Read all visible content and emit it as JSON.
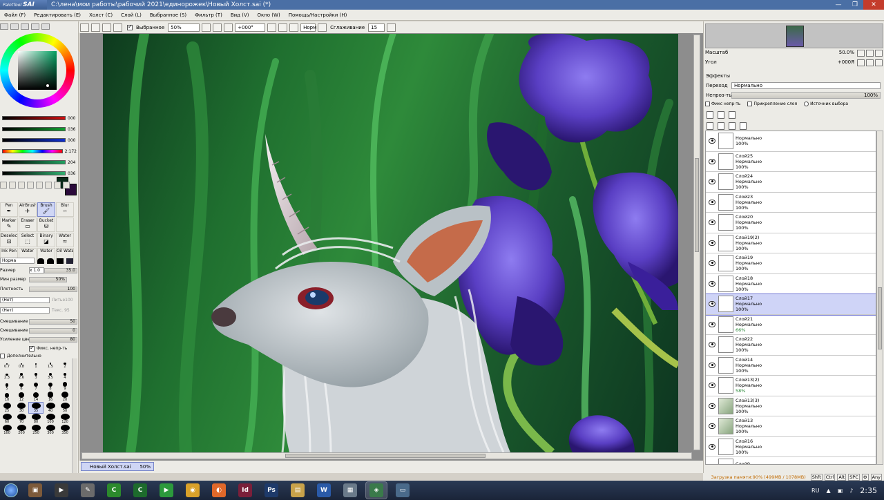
{
  "window": {
    "logo_top": "PaintTool",
    "logo_main": "SAI",
    "title": "C:\\лена\\мои работы\\рабочий 2021\\единорожек\\Новый Холст.sai (*)"
  },
  "menu": [
    "Файл (F)",
    "Редактировать (E)",
    "Холст (C)",
    "Слой (L)",
    "Выбранное (S)",
    "Фильтр (T)",
    "Вид (V)",
    "Окно (W)",
    "Помощь/Настройки (H)"
  ],
  "toolbar": {
    "selected_label": "Выбранное",
    "zoom": "50%",
    "angle": "+000°",
    "mode": "Норм",
    "smoothing_label": "Сглаживание",
    "smoothing_value": "15"
  },
  "color": {
    "sliders": [
      {
        "value": "000",
        "color": "#d01010"
      },
      {
        "value": "036",
        "color": "#10a030"
      },
      {
        "value": "000",
        "color": "#1030d0"
      },
      {
        "value": "2:172",
        "color": "#e050e0"
      },
      {
        "value": "204",
        "color": "#20a060"
      },
      {
        "value": "036",
        "color": "#30b070"
      }
    ],
    "foreground": "#0a2a1a",
    "background": "#2a0a3a"
  },
  "brushes": [
    {
      "label": "Pen",
      "glyph": "✒",
      "active": false
    },
    {
      "label": "AirBrush",
      "glyph": "✈",
      "active": false
    },
    {
      "label": "Brush",
      "glyph": "🖌",
      "active": true
    },
    {
      "label": "Blur",
      "glyph": "∽",
      "active": false
    },
    {
      "label": "Marker",
      "glyph": "✎",
      "active": false
    },
    {
      "label": "Eraser",
      "glyph": "▭",
      "active": false
    },
    {
      "label": "Bucket",
      "glyph": "⛁",
      "active": false
    },
    {
      "label": "",
      "glyph": "",
      "active": false
    },
    {
      "label": "Deselect",
      "glyph": "⊡",
      "active": false
    },
    {
      "label": "Select",
      "glyph": "⬚",
      "active": false
    },
    {
      "label": "Binary",
      "glyph": "◪",
      "active": false
    },
    {
      "label": "Water",
      "glyph": "≈",
      "active": false
    },
    {
      "label": "Ink Pen",
      "glyph": "",
      "active": false
    },
    {
      "label": "Water",
      "glyph": "",
      "active": false
    },
    {
      "label": "Water",
      "glyph": "",
      "active": false
    },
    {
      "label": "Oil Water",
      "glyph": "",
      "active": false
    }
  ],
  "brush_props": {
    "mode": "Норма",
    "size_label": "Размер",
    "size_mult": "x 1.0",
    "size_value": "35.0",
    "min_size_label": "Мин размер",
    "min_size_value": "50%",
    "density_label": "Плотность",
    "density_value": "100",
    "paper_1": "(Нет)",
    "paper_1_value": "Литье100",
    "paper_2": "(Нет)",
    "paper_2_value": "Текс. 95",
    "blend_label": "Смешивание цвет",
    "blend_value": "50",
    "dilution_label": "Смешивание непр",
    "dilution_value": "0",
    "persist_label": "Усиление цвета",
    "persist_value": "80",
    "keep_opacity": "Фикс. непр-ть",
    "advanced": "Дополнительно"
  },
  "brush_sizes": [
    "0.7",
    "0.8",
    "1",
    "1.5",
    "2",
    "2.3",
    "2.6",
    "3",
    "3.5",
    "4",
    "5",
    "6",
    "7",
    "8",
    "9",
    "10",
    "12",
    "14",
    "16",
    "20",
    "25",
    "30",
    "35",
    "40",
    "50",
    "60",
    "70",
    "80",
    "100",
    "120",
    "160",
    "200",
    "250",
    "300",
    "350"
  ],
  "selected_brush_size": "35",
  "doc_tab": {
    "name": "Новый Холст.sai",
    "zoom": "50%"
  },
  "navigator": {
    "zoom_label": "Масштаб",
    "zoom_value": "50.0%",
    "angle_label": "Угол",
    "angle_value": "+000Я"
  },
  "layer_panel": {
    "effects": "Эффекты",
    "blend_label": "Переход",
    "blend_value": "Нормально",
    "opacity_label": "Непроз-ть",
    "opacity_value": "100%",
    "preserve": "Фикс непр-ть",
    "clip": "Прикрепление слоя",
    "source": "Источник выбора"
  },
  "layers": [
    {
      "name": "",
      "mode": "Нормально",
      "opacity": "100%",
      "img": false,
      "active": false
    },
    {
      "name": "Слой25",
      "mode": "Нормально",
      "opacity": "100%",
      "img": false,
      "active": false
    },
    {
      "name": "Слой24",
      "mode": "Нормально",
      "opacity": "100%",
      "img": false,
      "active": false
    },
    {
      "name": "Слой23",
      "mode": "Нормально",
      "opacity": "100%",
      "img": false,
      "active": false
    },
    {
      "name": "Слой20",
      "mode": "Нормально",
      "opacity": "100%",
      "img": false,
      "active": false
    },
    {
      "name": "Слой19(2)",
      "mode": "Нормально",
      "opacity": "100%",
      "img": false,
      "active": false
    },
    {
      "name": "Слой19",
      "mode": "Нормально",
      "opacity": "100%",
      "img": false,
      "active": false
    },
    {
      "name": "Слой18",
      "mode": "Нормально",
      "opacity": "100%",
      "img": false,
      "active": false
    },
    {
      "name": "Слой17",
      "mode": "Нормально",
      "opacity": "100%",
      "img": false,
      "active": true
    },
    {
      "name": "Слой21",
      "mode": "Нормально",
      "opacity": "66%",
      "img": false,
      "active": false
    },
    {
      "name": "Слой22",
      "mode": "Нормально",
      "opacity": "100%",
      "img": false,
      "active": false
    },
    {
      "name": "Слой14",
      "mode": "Нормально",
      "opacity": "100%",
      "img": false,
      "active": false
    },
    {
      "name": "Слой13(2)",
      "mode": "Нормально",
      "opacity": "58%",
      "img": false,
      "active": false
    },
    {
      "name": "Слой13(3)",
      "mode": "Нормально",
      "opacity": "100%",
      "img": true,
      "active": false
    },
    {
      "name": "Слой13",
      "mode": "Нормально",
      "opacity": "100%",
      "img": true,
      "active": false
    },
    {
      "name": "Слой16",
      "mode": "Нормально",
      "opacity": "100%",
      "img": false,
      "active": false
    },
    {
      "name": "Слой9",
      "mode": "Нормально",
      "opacity": "",
      "img": false,
      "active": false
    }
  ],
  "status": {
    "memory": "Загрузка памяти:90% (499MB / 1078MB)",
    "keys": [
      "Shft",
      "Ctrl",
      "Alt",
      "SPC",
      "⚙",
      "Any"
    ]
  },
  "taskbar": {
    "apps": [
      {
        "name": "photo-viewer",
        "label": "▣",
        "color": "#7d5a3a"
      },
      {
        "name": "media",
        "label": "▶",
        "color": "#3a3a3a"
      },
      {
        "name": "paint",
        "label": "✎",
        "color": "#6b6b6b"
      },
      {
        "name": "camtasia",
        "label": "C",
        "color": "#2c8a2c"
      },
      {
        "name": "excel-like",
        "label": "C",
        "color": "#1d6b2c"
      },
      {
        "name": "play",
        "label": "▶",
        "color": "#2c9a3c"
      },
      {
        "name": "chrome",
        "label": "◉",
        "color": "#d9a12a"
      },
      {
        "name": "firefox",
        "label": "◐",
        "color": "#e0682a"
      },
      {
        "name": "indesign",
        "label": "Id",
        "color": "#7a1f3a"
      },
      {
        "name": "photoshop",
        "label": "Ps",
        "color": "#1e3a6a"
      },
      {
        "name": "explorer",
        "label": "▤",
        "color": "#c8a24a"
      },
      {
        "name": "word",
        "label": "W",
        "color": "#2a5aa8"
      },
      {
        "name": "calculator",
        "label": "▦",
        "color": "#6a7a8a"
      },
      {
        "name": "sai",
        "label": "◈",
        "color": "#3a7a4a"
      },
      {
        "name": "window",
        "label": "▭",
        "color": "#4a6a8a"
      }
    ],
    "lang": "RU",
    "time": "2:35"
  }
}
